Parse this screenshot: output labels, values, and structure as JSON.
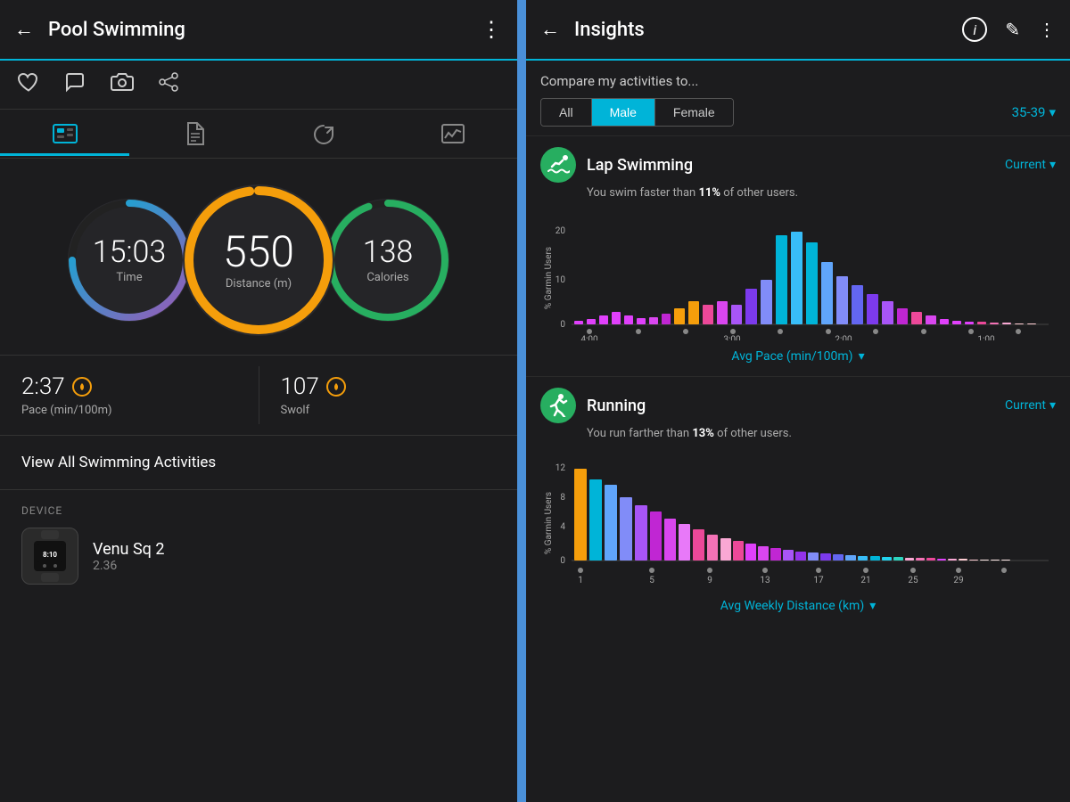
{
  "left": {
    "header": {
      "back_label": "←",
      "title": "Pool Swimming",
      "more": "⋮"
    },
    "action_icons": [
      "♡",
      "💬",
      "📷",
      "↗"
    ],
    "tabs": [
      {
        "label": "📊",
        "active": true
      },
      {
        "label": "📄",
        "active": false
      },
      {
        "label": "🔄",
        "active": false
      },
      {
        "label": "📈",
        "active": false
      }
    ],
    "metrics": {
      "time": {
        "value": "15:03",
        "label": "Time"
      },
      "distance": {
        "value": "550",
        "sublabel": "Distance (m)"
      },
      "calories": {
        "value": "138",
        "label": "Calories"
      }
    },
    "stats": [
      {
        "value": "2:37",
        "label": "Pace (min/100m)",
        "has_icon": true
      },
      {
        "value": "107",
        "label": "Swolf",
        "has_icon": true
      }
    ],
    "view_all": "View All Swimming Activities",
    "device": {
      "section_label": "DEVICE",
      "name": "Venu Sq 2",
      "version": "2.36"
    }
  },
  "right": {
    "header": {
      "back_label": "←",
      "title": "Insights",
      "icon_info": "i",
      "icon_edit": "✎",
      "icon_more": "⋮"
    },
    "compare_label": "Compare my activities to...",
    "filter_buttons": [
      "All",
      "Male",
      "Female"
    ],
    "active_filter": "Male",
    "age_range": "35-39",
    "cards": [
      {
        "id": "lap_swimming",
        "icon": "🏊",
        "name": "Lap Swimming",
        "current_label": "Current",
        "description": "You swim faster than <strong>11%</strong> of other users.",
        "description_plain": "You swim faster than 11% of other users.",
        "description_bold": "11%",
        "chart_x_label": "Avg Pace (min/100m)",
        "chart_x_axis": [
          "4:00",
          "3:00",
          "2:00",
          "1:00"
        ],
        "y_max": 20,
        "y_ticks": [
          0,
          10,
          20
        ]
      },
      {
        "id": "running",
        "icon": "🏃",
        "name": "Running",
        "current_label": "Current",
        "description": "You run farther than <strong>13%</strong> of other users.",
        "description_plain": "You run farther than 13% of other users.",
        "description_bold": "13%",
        "chart_x_label": "Avg Weekly Distance (km)",
        "chart_x_axis": [
          "1",
          "5",
          "9",
          "13",
          "17",
          "21",
          "25",
          "29"
        ],
        "y_max": 12,
        "y_ticks": [
          0,
          4,
          8,
          12
        ]
      }
    ]
  }
}
